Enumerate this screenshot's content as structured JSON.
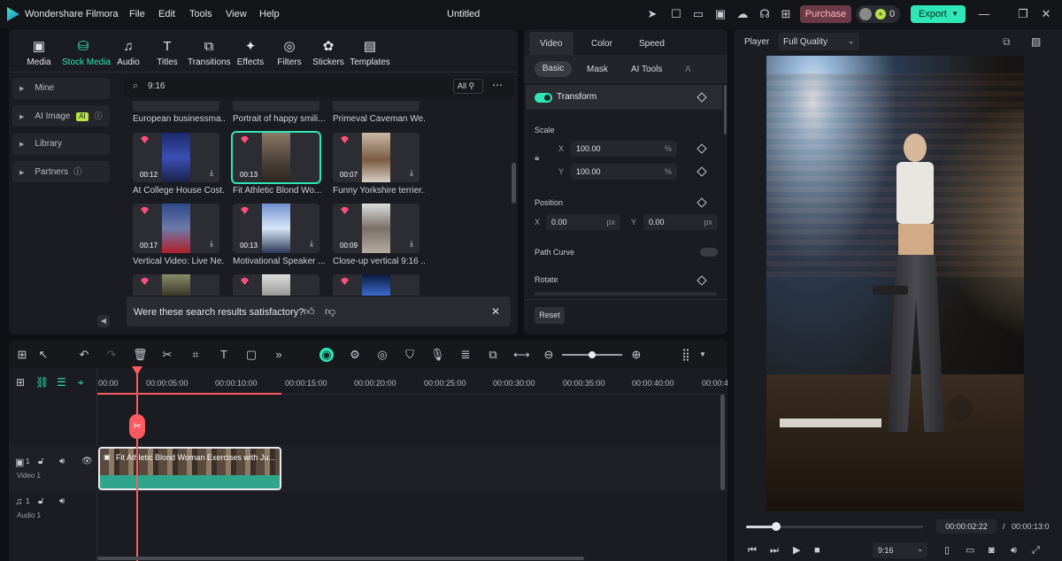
{
  "app": {
    "name": "Wondershare Filmora",
    "title": "Untitled"
  },
  "menu": [
    "File",
    "Edit",
    "Tools",
    "View",
    "Help"
  ],
  "titlebar": {
    "purchase": "Purchase",
    "credits": "0",
    "export": "Export"
  },
  "media_tabs": [
    {
      "label": "Media",
      "icon": "media-icon"
    },
    {
      "label": "Stock Media",
      "icon": "stock-media-icon"
    },
    {
      "label": "Audio",
      "icon": "audio-icon"
    },
    {
      "label": "Titles",
      "icon": "titles-icon"
    },
    {
      "label": "Transitions",
      "icon": "transitions-icon"
    },
    {
      "label": "Effects",
      "icon": "effects-icon"
    },
    {
      "label": "Filters",
      "icon": "filters-icon"
    },
    {
      "label": "Stickers",
      "icon": "stickers-icon"
    },
    {
      "label": "Templates",
      "icon": "templates-icon"
    }
  ],
  "sidebar": {
    "mine": "Mine",
    "ai_image": "AI Image",
    "ai_badge": "AI",
    "library": "Library",
    "partners": "Partners"
  },
  "search": {
    "value": "9:16",
    "filter": "All"
  },
  "top_captions": [
    "European businessma...",
    "Portrait of happy smili...",
    "Primeval Caveman We..."
  ],
  "clips": [
    {
      "duration": "00:12",
      "caption": "At College House Cost..."
    },
    {
      "duration": "00:13",
      "caption": "Fit Athletic Blond Wo..."
    },
    {
      "duration": "00:07",
      "caption": "Funny Yorkshire terrier..."
    },
    {
      "duration": "00:17",
      "caption": "Vertical Video: Live Ne..."
    },
    {
      "duration": "00:13",
      "caption": "Motivational Speaker ..."
    },
    {
      "duration": "00:09",
      "caption": "Close-up vertical 9:16 ..."
    }
  ],
  "feedback": {
    "text": "Were these search results satisfactory?"
  },
  "props": {
    "tabs": [
      "Video",
      "Color",
      "Speed"
    ],
    "subtabs": [
      "Basic",
      "Mask",
      "AI Tools",
      "A"
    ],
    "transform": "Transform",
    "scale": "Scale",
    "scale_x": "100.00",
    "scale_y": "100.00",
    "x": "X",
    "y": "Y",
    "percent": "%",
    "px": "px",
    "position": "Position",
    "pos_x": "0.00",
    "pos_y": "0.00",
    "path_curve": "Path Curve",
    "rotate": "Rotate",
    "reset": "Reset"
  },
  "player": {
    "label": "Player",
    "quality": "Full Quality",
    "time_current": "00:00:02:22",
    "separator": "/",
    "time_total": "00:00:13:0",
    "ratio": "9:16",
    "progress": 0.17
  },
  "timeline": {
    "ruler": [
      "00:00",
      "00:00:05:00",
      "00:00:10:00",
      "00:00:15:00",
      "00:00:20:00",
      "00:00:25:00",
      "00:00:30:00",
      "00:00:35:00",
      "00:00:40:00",
      "00:00:4"
    ],
    "clip_title": "Fit Athletic Blond Woman Exercises with Ju...",
    "video_track": "Video 1",
    "audio_track": "Audio 1",
    "track_num": "1"
  },
  "colors": {
    "accent": "#2fe6b6",
    "playhead": "#ff5a5f"
  }
}
